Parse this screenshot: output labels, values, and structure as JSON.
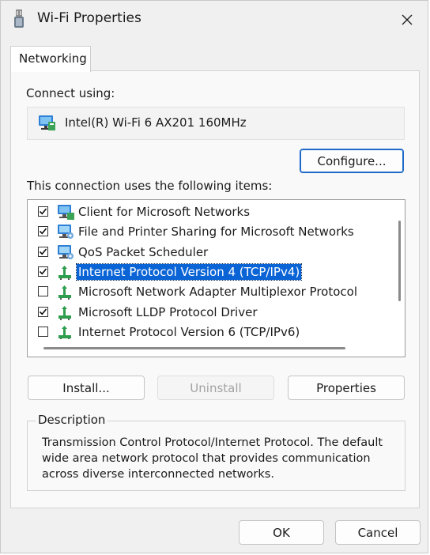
{
  "window": {
    "title": "Wi-Fi Properties",
    "close_glyph": "✕"
  },
  "tabs": [
    {
      "label": "Networking",
      "active": true
    }
  ],
  "connect_using": {
    "label": "Connect using:",
    "adapter_name": "Intel(R) Wi-Fi 6 AX201 160MHz",
    "icon": "network-adapter-icon"
  },
  "configure_button": "Configure...",
  "items_label": "This connection uses the following items:",
  "items": [
    {
      "label": "Client for Microsoft Networks",
      "checked": true,
      "icon": "network-client-icon",
      "selected": false
    },
    {
      "label": "File and Printer Sharing for Microsoft Networks",
      "checked": true,
      "icon": "network-service-icon",
      "selected": false
    },
    {
      "label": "QoS Packet Scheduler",
      "checked": true,
      "icon": "network-service-icon",
      "selected": false
    },
    {
      "label": "Internet Protocol Version 4 (TCP/IPv4)",
      "checked": true,
      "icon": "protocol-icon",
      "selected": true
    },
    {
      "label": "Microsoft Network Adapter Multiplexor Protocol",
      "checked": false,
      "icon": "protocol-icon",
      "selected": false
    },
    {
      "label": "Microsoft LLDP Protocol Driver",
      "checked": true,
      "icon": "protocol-icon",
      "selected": false
    },
    {
      "label": "Internet Protocol Version 6 (TCP/IPv6)",
      "checked": false,
      "icon": "protocol-icon",
      "selected": false
    }
  ],
  "buttons": {
    "install": "Install...",
    "uninstall": "Uninstall",
    "properties": "Properties",
    "ok": "OK",
    "cancel": "Cancel"
  },
  "description": {
    "legend": "Description",
    "text": "Transmission Control Protocol/Internet Protocol. The default wide area network protocol that provides communication across diverse interconnected networks."
  },
  "colors": {
    "selection": "#0a64d6",
    "default_button_border": "#1f6ac9",
    "window_bg": "#f0f0f0"
  }
}
